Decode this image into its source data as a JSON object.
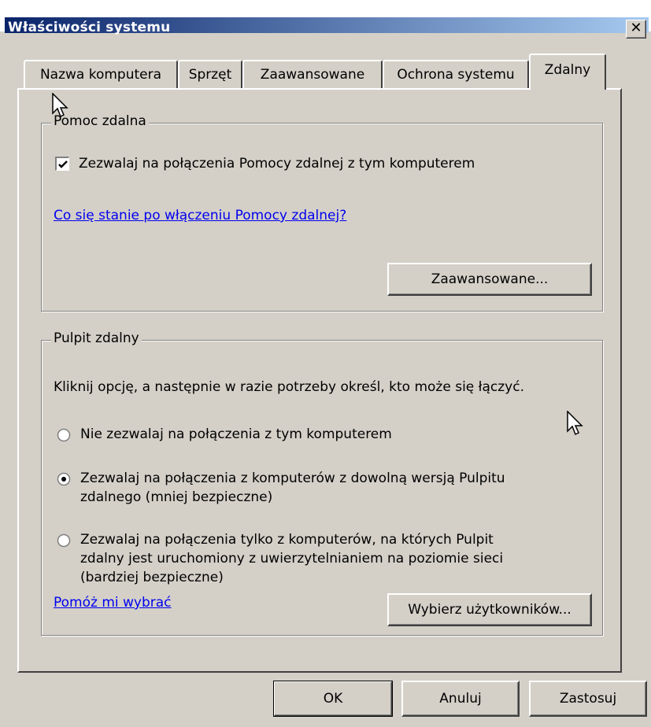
{
  "window": {
    "title": "Właściwości systemu",
    "close_glyph": "✕"
  },
  "tabs": [
    {
      "label": "Nazwa komputera",
      "active": false
    },
    {
      "label": "Sprzęt",
      "active": false
    },
    {
      "label": "Zaawansowane",
      "active": false
    },
    {
      "label": "Ochrona systemu",
      "active": false
    },
    {
      "label": "Zdalny",
      "active": true
    }
  ],
  "remote_assistance": {
    "legend": "Pomoc zdalna",
    "allow_checkbox_label": "Zezwalaj na połączenia Pomocy zdalnej z tym komputerem",
    "allow_checked": true,
    "help_link": "Co się stanie po włączeniu Pomocy zdalnej?",
    "advanced_button": "Zaawansowane..."
  },
  "remote_desktop": {
    "legend": "Pulpit zdalny",
    "instruction": "Kliknij opcję, a następnie w razie potrzeby określ, kto może się łączyć.",
    "options": [
      {
        "label_line1": "Nie zezwalaj na połączenia z tym komputerem",
        "label_line2": "",
        "label_line3": "",
        "selected": false
      },
      {
        "label_line1": "Zezwalaj na połączenia z komputerów z dowolną wersją Pulpitu",
        "label_line2": "zdalnego (mniej bezpieczne)",
        "label_line3": "",
        "selected": true
      },
      {
        "label_line1": "Zezwalaj na połączenia tylko z komputerów, na których Pulpit",
        "label_line2": "zdalny jest uruchomiony z uwierzytelnianiem na poziomie sieci",
        "label_line3": "(bardziej bezpieczne)",
        "selected": false
      }
    ],
    "help_link": "Pomóż mi wybrać",
    "select_users_button": "Wybierz użytkowników..."
  },
  "footer": {
    "ok": "OK",
    "cancel": "Anuluj",
    "apply": "Zastosuj"
  },
  "colors": {
    "titlebar_start": "#0a246a",
    "titlebar_end": "#a6caf0",
    "face": "#d4d0c8",
    "link": "#0000ee"
  }
}
